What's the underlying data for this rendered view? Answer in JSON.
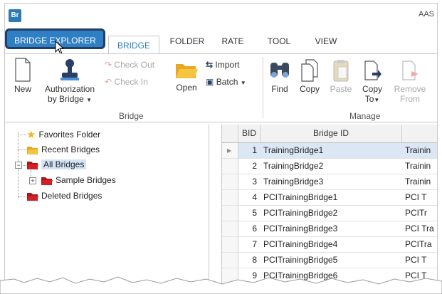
{
  "app": {
    "icon_text": "Br",
    "title": "AAS"
  },
  "tabs": [
    {
      "label": "BRIDGE EXPLORER"
    },
    {
      "label": "BRIDGE"
    },
    {
      "label": "FOLDER"
    },
    {
      "label": "RATE"
    },
    {
      "label": "TOOL"
    },
    {
      "label": "VIEW"
    }
  ],
  "ribbon": {
    "new": "New",
    "authorization_line1": "Authorization",
    "authorization_line2": "by Bridge",
    "check_out": "Check Out",
    "check_in": "Check In",
    "open": "Open",
    "import": "Import",
    "batch": "Batch",
    "find": "Find",
    "copy": "Copy",
    "paste": "Paste",
    "copy_to_line1": "Copy",
    "copy_to_line2": "To",
    "remove_from_line1": "Remove",
    "remove_from_line2": "From",
    "group_bridge": "Bridge",
    "group_manage": "Manage"
  },
  "tree": {
    "favorites": "Favorites Folder",
    "recent": "Recent Bridges",
    "all": "All Bridges",
    "sample": "Sample Bridges",
    "deleted": "Deleted Bridges"
  },
  "grid": {
    "headers": {
      "bid": "BID",
      "bridge_id": "Bridge ID"
    },
    "rows": [
      {
        "bid": "1",
        "bridge_id": "TrainingBridge1",
        "name": "Trainin"
      },
      {
        "bid": "2",
        "bridge_id": "TrainingBridge2",
        "name": "Trainin"
      },
      {
        "bid": "3",
        "bridge_id": "TrainingBridge3",
        "name": "Trainin"
      },
      {
        "bid": "4",
        "bridge_id": "PCITrainingBridge1",
        "name": "PCI T"
      },
      {
        "bid": "5",
        "bridge_id": "PCITrainingBridge2",
        "name": "PCITr"
      },
      {
        "bid": "6",
        "bridge_id": "PCITrainingBridge3",
        "name": "PCI Tra"
      },
      {
        "bid": "7",
        "bridge_id": "PCITrainingBridge4",
        "name": "PCITra"
      },
      {
        "bid": "8",
        "bridge_id": "PCITrainingBridge5",
        "name": "PCI T"
      },
      {
        "bid": "9",
        "bridge_id": "PCITrainingBridge6",
        "name": "PCI T"
      }
    ]
  },
  "colors": {
    "accent": "#2f7fc4",
    "selection": "#dbe7f5",
    "folder_red": "#d32027",
    "folder_yellow": "#f0b429"
  }
}
